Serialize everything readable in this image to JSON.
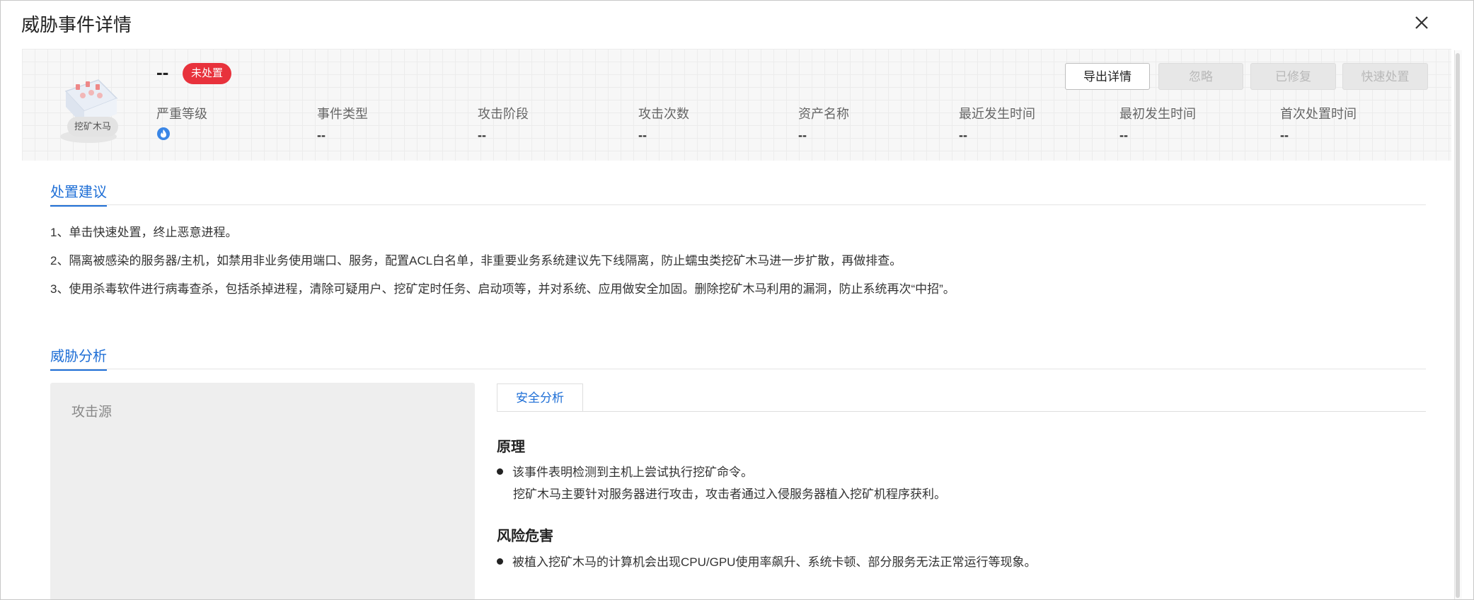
{
  "dialog": {
    "title": "威胁事件详情"
  },
  "event": {
    "tag": "挖矿木马",
    "name": "--",
    "status": "未处置"
  },
  "actions": {
    "export": "导出详情",
    "ignore": "忽略",
    "fixed": "已修复",
    "quick": "快速处置"
  },
  "fields": [
    {
      "label": "严重等级",
      "value": ""
    },
    {
      "label": "事件类型",
      "value": "--"
    },
    {
      "label": "攻击阶段",
      "value": "--"
    },
    {
      "label": "攻击次数",
      "value": "--"
    },
    {
      "label": "资产名称",
      "value": "--"
    },
    {
      "label": "最近发生时间",
      "value": "--"
    },
    {
      "label": "最初发生时间",
      "value": "--"
    },
    {
      "label": "首次处置时间",
      "value": "--"
    }
  ],
  "advice": {
    "title": "处置建议",
    "items": [
      "1、单击快速处置，终止恶意进程。",
      "2、隔离被感染的服务器/主机，如禁用非业务使用端口、服务，配置ACL白名单，非重要业务系统建议先下线隔离，防止蠕虫类挖矿木马进一步扩散，再做排查。",
      "3、使用杀毒软件进行病毒查杀，包括杀掉进程，清除可疑用户、挖矿定时任务、启动项等，并对系统、应用做安全加固。删除挖矿木马利用的漏洞，防止系统再次“中招”。"
    ]
  },
  "analysis": {
    "title": "威胁分析",
    "source_title": "攻击源",
    "tab": "安全分析",
    "principle_heading": "原理",
    "principle_line1": "该事件表明检测到主机上尝试执行挖矿命令。",
    "principle_line2": "挖矿木马主要针对服务器进行攻击，攻击者通过入侵服务器植入挖矿机程序获利。",
    "risk_heading": "风险危害",
    "risk_line1": "被植入挖矿木马的计算机会出现CPU/GPU使用率飙升、系统卡顿、部分服务无法正常运行等现象。"
  },
  "icons": {
    "close": "close-icon",
    "severity": "flame-icon"
  },
  "colors": {
    "accent": "#1f6fd6",
    "status": "#e8323c"
  }
}
